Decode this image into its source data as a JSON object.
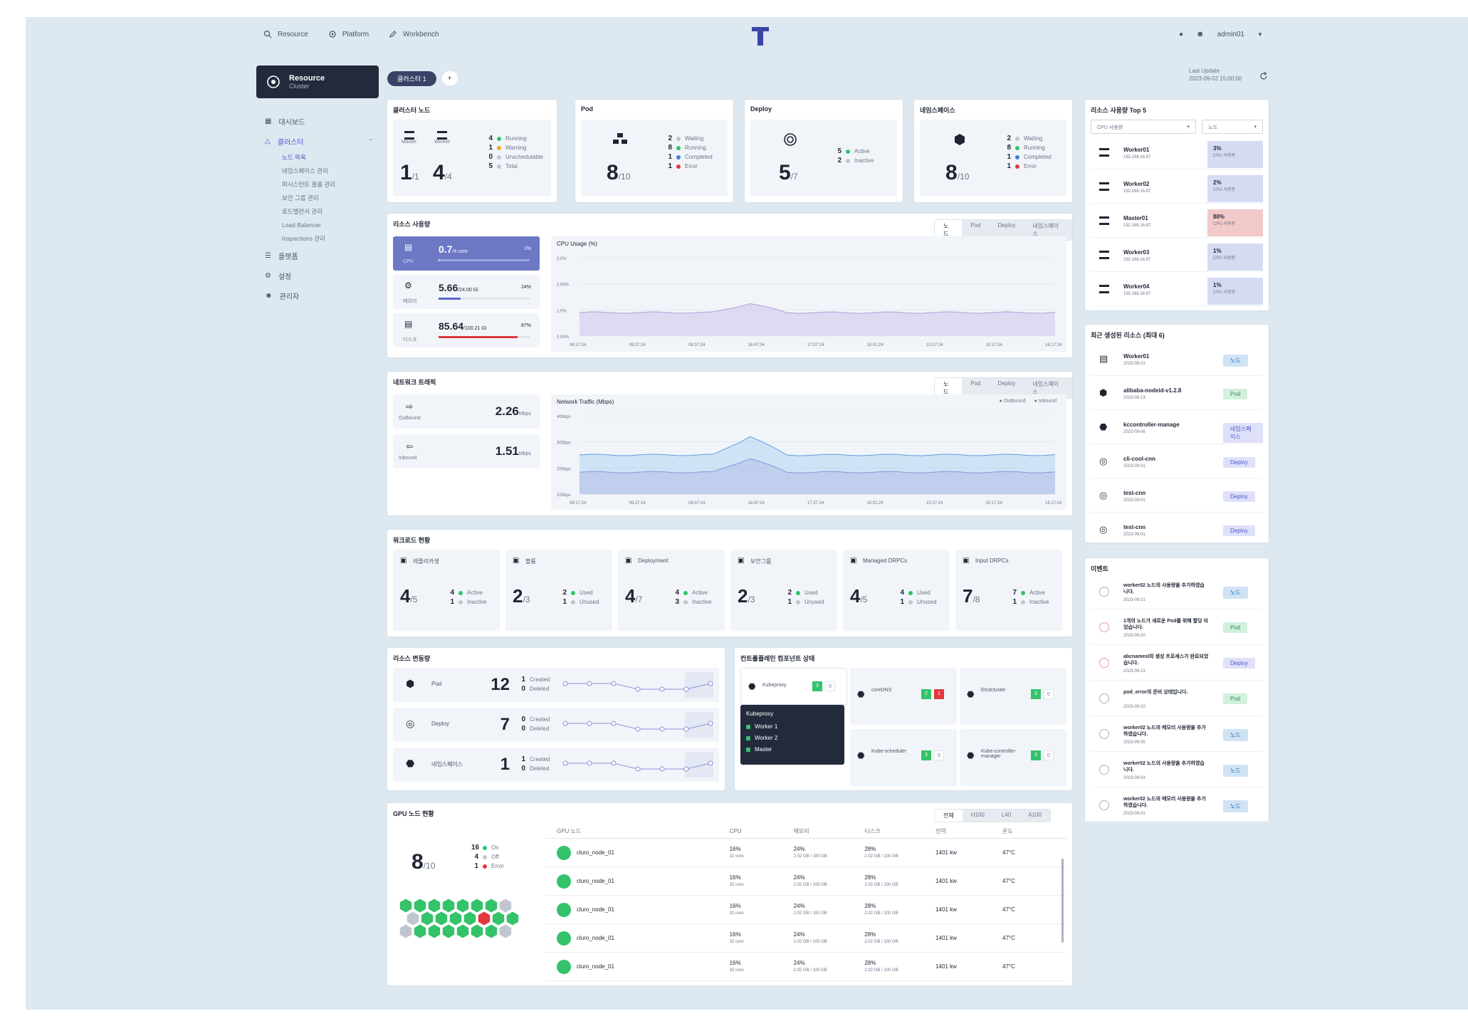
{
  "topnav": [
    {
      "label": "Resource",
      "icon": "search-icon"
    },
    {
      "label": "Platform",
      "icon": "gear-icon"
    },
    {
      "label": "Workbench",
      "icon": "pencil-icon"
    }
  ],
  "user": {
    "name": "admin01"
  },
  "brand": {
    "title": "Resource",
    "subtitle": "Cluster"
  },
  "menu": {
    "items": [
      "대시보드",
      "클러스터",
      "플랫폼",
      "설정",
      "관리자"
    ],
    "sub": [
      "노드 목록",
      "네임스페이스 관리",
      "퍼시스턴트 볼륨 관리",
      "보안 그룹 관리",
      "로드밸런서 관리",
      "Load Balancer",
      "Inspections 관리"
    ]
  },
  "header": {
    "pill": "클러스터 1",
    "add": "+",
    "last_update_label": "Last Update",
    "last_update_value": "2023-09-02 15:00:00"
  },
  "summary": {
    "node": {
      "title": "클러스터 노드",
      "master_label": "Master",
      "worker_label": "Worker",
      "master": "1",
      "master_total": "/1",
      "worker": "4",
      "worker_total": "/4",
      "stats": [
        {
          "n": "4",
          "label": "Running",
          "color": "#34c26b"
        },
        {
          "n": "1",
          "label": "Warning",
          "color": "#f5a623"
        },
        {
          "n": "0",
          "label": "Unschedulable",
          "color": "#c0c6d0"
        },
        {
          "n": "5",
          "label": "Total",
          "color": "#c0c6d0"
        }
      ]
    },
    "pod": {
      "title": "Pod",
      "num": "8",
      "total": "/10",
      "stats": [
        {
          "n": "2",
          "label": "Waiting",
          "color": "#c0c6d0"
        },
        {
          "n": "8",
          "label": "Running",
          "color": "#34c26b"
        },
        {
          "n": "1",
          "label": "Completed",
          "color": "#3f82d8"
        },
        {
          "n": "1",
          "label": "Error",
          "color": "#e0383e"
        }
      ]
    },
    "deploy": {
      "title": "Deploy",
      "num": "5",
      "total": "/7",
      "stats": [
        {
          "n": "5",
          "label": "Active",
          "color": "#34c26b"
        },
        {
          "n": "2",
          "label": "Inactive",
          "color": "#c0c6d0"
        }
      ]
    },
    "ns": {
      "title": "네임스페이스",
      "num": "8",
      "total": "/10",
      "stats": [
        {
          "n": "2",
          "label": "Waiting",
          "color": "#c0c6d0"
        },
        {
          "n": "8",
          "label": "Running",
          "color": "#34c26b"
        },
        {
          "n": "1",
          "label": "Completed",
          "color": "#3f82d8"
        },
        {
          "n": "1",
          "label": "Error",
          "color": "#e0383e"
        }
      ]
    }
  },
  "resource": {
    "title": "리소스 사용량",
    "tabs": [
      "노드",
      "Pod",
      "Deploy",
      "네임스페이스"
    ],
    "items": [
      {
        "label": "CPU",
        "value": "0.7",
        "unit": "/4 core",
        "pct": "1%",
        "fill": 0.01
      },
      {
        "label": "메모리",
        "value": "5.66",
        "unit": "/24.00 Gi",
        "pct": "24%",
        "fill": 0.24
      },
      {
        "label": "디스크",
        "value": "85.64",
        "unit": "/100.21 Gi",
        "pct": "87%",
        "fill": 0.87
      }
    ],
    "chart_label": "CPU Usage (%)",
    "yticks": [
      "3.0%",
      "2.00%",
      "1.0%",
      "0.00%"
    ],
    "xticks": [
      "08:17:24",
      "08:27:24",
      "08:37:24",
      "16:47:24",
      "17:07:24",
      "10:01:24",
      "10:17:24",
      "10:17:24",
      "16:17:24"
    ]
  },
  "network": {
    "title": "네트워크 트래픽",
    "tabs": [
      "노드",
      "Pod",
      "Deploy",
      "네임스페이스"
    ],
    "outbound_label": "Outbound",
    "outbound_value": "2.26",
    "outbound_unit": "Mbps",
    "inbound_label": "Inbound",
    "inbound_value": "1.51",
    "inbound_unit": "Mbps",
    "chart_label": "Network Traffic (Mbps)",
    "legend_out": "Outbound",
    "legend_in": "Inbound",
    "yticks": [
      "400bps",
      "300bps",
      "200bps",
      "100bps"
    ],
    "xticks": [
      "08:17:24",
      "08:27:24",
      "08:37:24",
      "16:47:24",
      "17:07:24",
      "10:01:24",
      "10:17:24",
      "10:17:24",
      "16:17:24"
    ]
  },
  "workload": {
    "title": "워크로드 현황",
    "items": [
      {
        "label": "레플리카셋",
        "num": "4",
        "total": "/5",
        "a": "4",
        "a_label": "Active",
        "b": "1",
        "b_label": "Inactive"
      },
      {
        "label": "볼륨",
        "num": "2",
        "total": "/3",
        "a": "2",
        "a_label": "Used",
        "b": "1",
        "b_label": "Unused"
      },
      {
        "label": "Deployment",
        "num": "4",
        "total": "/7",
        "a": "4",
        "a_label": "Active",
        "b": "3",
        "b_label": "Inactive"
      },
      {
        "label": "보안그룹",
        "num": "2",
        "total": "/3",
        "a": "2",
        "a_label": "Used",
        "b": "1",
        "b_label": "Unused"
      },
      {
        "label": "Managed DRPCs",
        "num": "4",
        "total": "/5",
        "a": "4",
        "a_label": "Used",
        "b": "1",
        "b_label": "Unused"
      },
      {
        "label": "Input DRPCs",
        "num": "7",
        "total": "/8",
        "a": "7",
        "a_label": "Active",
        "b": "1",
        "b_label": "Inactive"
      }
    ]
  },
  "events": {
    "title": "리소스 변동량",
    "rows": [
      {
        "label": "Pod",
        "num": "12",
        "c": "1",
        "c_label": "Created",
        "d": "0",
        "d_label": "Deleted"
      },
      {
        "label": "Deploy",
        "num": "7",
        "c": "0",
        "c_label": "Created",
        "d": "0",
        "d_label": "Deleted"
      },
      {
        "label": "네임스페이스",
        "num": "1",
        "c": "1",
        "c_label": "Created",
        "d": "0",
        "d_label": "Deleted"
      }
    ]
  },
  "components": {
    "title": "컨트롤플레인 컴포넌트 상태",
    "items": [
      {
        "label": "Kubeproxy",
        "ok": "3",
        "err": "0"
      },
      {
        "label": "coreDNS",
        "ok": "2",
        "err": "1"
      },
      {
        "label": "Etcdcluster",
        "ok": "3",
        "err": "0"
      },
      {
        "label": "Kube-scheduler",
        "ok": "3",
        "err": "0"
      },
      {
        "label": "Kube-controller-manager",
        "ok": "3",
        "err": "0"
      }
    ],
    "popup_title": "Kubeproxy",
    "popup_items": [
      "Worker 1",
      "Worker 2",
      "Master"
    ]
  },
  "gpu": {
    "title": "GPU 노드 현황",
    "tabs": [
      "전체",
      "H100",
      "L40",
      "A100"
    ],
    "num": "8",
    "total": "/10",
    "stats": [
      {
        "n": "16",
        "label": "On",
        "color": "#34c26b"
      },
      {
        "n": "4",
        "label": "Off",
        "color": "#c0c6d0"
      },
      {
        "n": "1",
        "label": "Error",
        "color": "#e0383e"
      }
    ],
    "columns": [
      "GPU 노드",
      "CPU",
      "메모리",
      "디스크",
      "전력",
      "온도"
    ],
    "rows": [
      {
        "name": "cluro_node_01",
        "cpu": "16%",
        "cpu_sub": "32 core",
        "mem": "24%",
        "mem_sub": "2.02 GB / 100 GB",
        "disk": "28%",
        "disk_sub": "2.02 GB / 100 GB",
        "power": "1401 kw",
        "temp": "47°C"
      },
      {
        "name": "cluro_node_01",
        "cpu": "16%",
        "cpu_sub": "32 core",
        "mem": "24%",
        "mem_sub": "2.02 GB / 100 GB",
        "disk": "28%",
        "disk_sub": "2.02 GB / 100 GB",
        "power": "1401 kw",
        "temp": "47°C"
      },
      {
        "name": "cluro_node_01",
        "cpu": "16%",
        "cpu_sub": "32 core",
        "mem": "24%",
        "mem_sub": "2.02 GB / 100 GB",
        "disk": "28%",
        "disk_sub": "2.02 GB / 100 GB",
        "power": "1401 kw",
        "temp": "47°C"
      },
      {
        "name": "cluro_node_01",
        "cpu": "16%",
        "cpu_sub": "32 core",
        "mem": "24%",
        "mem_sub": "2.02 GB / 100 GB",
        "disk": "28%",
        "disk_sub": "2.02 GB / 100 GB",
        "power": "1401 kw",
        "temp": "47°C"
      },
      {
        "name": "cluro_node_01",
        "cpu": "16%",
        "cpu_sub": "32 core",
        "mem": "24%",
        "mem_sub": "2.02 GB / 100 GB",
        "disk": "28%",
        "disk_sub": "2.02 GB / 100 GB",
        "power": "1401 kw",
        "temp": "47°C"
      }
    ]
  },
  "top5": {
    "title": "리소스 사용량 Top 5",
    "select1": "CPU 사용량",
    "select2": "노드",
    "items": [
      {
        "name": "Worker01",
        "ip": "192.168.16.87",
        "pct": "3%",
        "sub": "CPU 사용량",
        "level": "normal"
      },
      {
        "name": "Worker02",
        "ip": "192.168.16.87",
        "pct": "2%",
        "sub": "CPU 사용량",
        "level": "normal"
      },
      {
        "name": "Master01",
        "ip": "192.168.16.87",
        "pct": "80%",
        "sub": "CPU 사용량",
        "level": "high"
      },
      {
        "name": "Worker03",
        "ip": "192.168.16.87",
        "pct": "1%",
        "sub": "CPU 사용량",
        "level": "normal"
      },
      {
        "name": "Worker04",
        "ip": "192.168.16.87",
        "pct": "1%",
        "sub": "CPU 사용량",
        "level": "normal"
      }
    ]
  },
  "recent": {
    "title": "최근 생성된 리소스 (최대 6)",
    "items": [
      {
        "name": "Worker01",
        "date": "2023-09-21",
        "type": "노드",
        "kind": "node",
        "icon": "server-icon"
      },
      {
        "name": "alibaba-nodeid-v1.2.8",
        "date": "2023-09-13",
        "type": "Pod",
        "kind": "pod",
        "icon": "pod-icon"
      },
      {
        "name": "kccontroller-manage",
        "date": "2023-09-06",
        "type": "네임스페이스",
        "kind": "dep",
        "icon": "namespace-icon"
      },
      {
        "name": "cli-cool-cnn",
        "date": "2023-09-01",
        "type": "Deploy",
        "kind": "dep",
        "icon": "deploy-icon"
      },
      {
        "name": "test-cnn",
        "date": "2023-09-01",
        "type": "Deploy",
        "kind": "dep",
        "icon": "deploy-icon"
      },
      {
        "name": "test-cnn",
        "date": "2023-09-01",
        "type": "Deploy",
        "kind": "dep",
        "icon": "deploy-icon"
      }
    ]
  },
  "alerts": {
    "title": "이벤트",
    "items": [
      {
        "text": "worker02 노드의 사용량을 추가하였습니다.",
        "date": "2023-09-21",
        "type": "노드",
        "kind": "node",
        "level": "info"
      },
      {
        "text": "1개의 노드가 새로운 Pod를 위해 할당 되었습니다.",
        "date": "2023-09-20",
        "type": "Pod",
        "kind": "pod",
        "level": "error"
      },
      {
        "text": "abcnamesl의 생성 프로세스가 완료되었습니다.",
        "date": "2023-09-13",
        "type": "Deploy",
        "kind": "dep",
        "level": "error"
      },
      {
        "text": "pod_error의 준비 상태입니다.",
        "date": "2023-09-10",
        "type": "Pod",
        "kind": "pod",
        "level": "info"
      },
      {
        "text": "worker02 노드의 메모리 사용량을 추가하였습니다.",
        "date": "2023-09-05",
        "type": "노드",
        "kind": "node",
        "level": "info"
      },
      {
        "text": "worker02 노드의 사용량을 추가하였습니다.",
        "date": "2023-09-03",
        "type": "노드",
        "kind": "node",
        "level": "info"
      },
      {
        "text": "worker02 노드의 메모리 사용량을 추가하였습니다.",
        "date": "2023-09-01",
        "type": "노드",
        "kind": "node",
        "level": "info"
      }
    ]
  },
  "colors": {
    "accent": "#4b56c9",
    "dark": "#232a3b",
    "running": "#34c26b",
    "error": "#e0383e",
    "cpu_fill": "#6c78c4"
  }
}
